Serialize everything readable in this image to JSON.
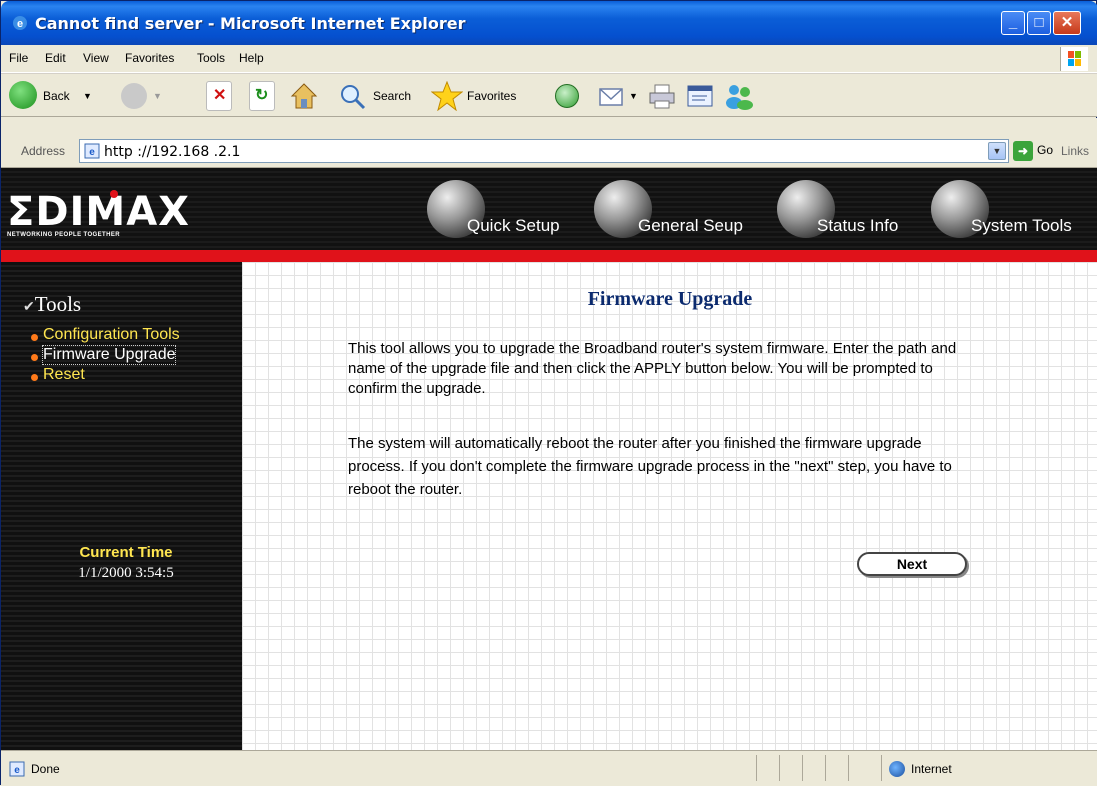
{
  "window": {
    "title": "Cannot find server - Microsoft Internet Explorer"
  },
  "menubar": {
    "items": [
      "File",
      "Edit",
      "View",
      "Favorites",
      "Tools",
      "Help"
    ]
  },
  "toolbar": {
    "back": "Back",
    "search": "Search",
    "favorites": "Favorites"
  },
  "address": {
    "label": "Address",
    "url": "http ://192.168 .2.1",
    "go": "Go",
    "links": "Links"
  },
  "header": {
    "logo": "ΣDIMAX",
    "tagline": "NETWORKING PEOPLE TOGETHER",
    "nav": [
      "Quick Setup",
      "General Seup",
      "Status Info",
      "System Tools"
    ]
  },
  "sidebar": {
    "title": "Tools",
    "items": [
      "Configuration Tools",
      "Firmware Upgrade",
      "Reset"
    ],
    "active_item": "Firmware Upgrade",
    "current_time_label": "Current Time",
    "current_time_value": "1/1/2000 3:54:5"
  },
  "main": {
    "heading": "Firmware Upgrade",
    "paragraph1": "This tool allows you to upgrade the Broadband router's system firmware. Enter the path and name of the upgrade file and then click the APPLY button below. You will be prompted to confirm the upgrade.",
    "paragraph2": "The system will automatically reboot the router after you finished the firmware upgrade process. If you don't complete the firmware upgrade process in the \"next\" step, you have to reboot the router.",
    "next_button": "Next"
  },
  "statusbar": {
    "status": "Done",
    "zone": "Internet"
  },
  "colors": {
    "accent_red": "#e0121a",
    "link_yellow": "#ffe650",
    "heading_blue": "#0b2a6e",
    "titlebar_blue": "#0b5ed7"
  }
}
